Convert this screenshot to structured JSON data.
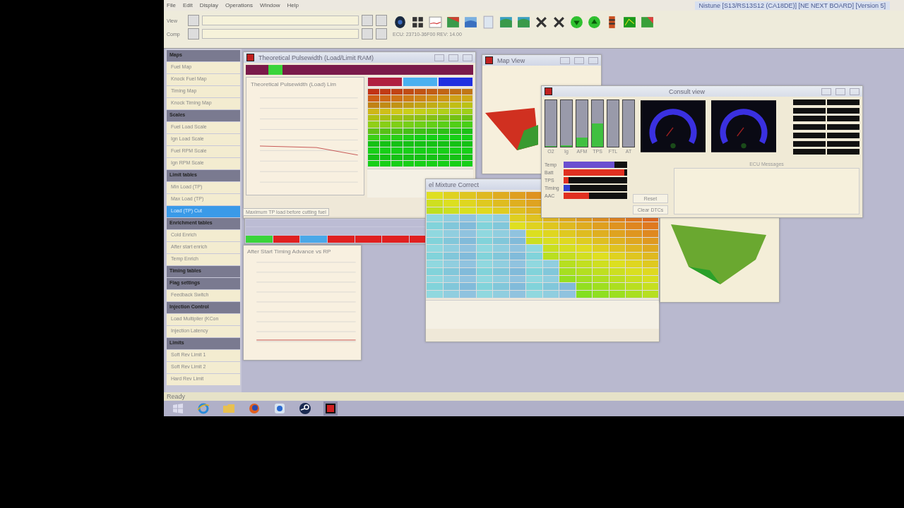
{
  "title": "Nistune [S13/RS13S12 (CA18DE)] [NE NEXT BOARD] [Version 5]",
  "menu": [
    "File",
    "Edit",
    "Display",
    "Operations",
    "Window",
    "Help"
  ],
  "toolbar": {
    "rows": [
      {
        "label": "View"
      },
      {
        "label": "Comp"
      }
    ],
    "ecu_info": "ECU: 23710-36F00 REV: 14.00"
  },
  "sidebar": {
    "groups": [
      {
        "label": "Maps",
        "children": [
          {
            "label": "Fuel Map",
            "selected": false
          },
          {
            "label": "Knock Fuel Map",
            "selected": false
          },
          {
            "label": "Timing Map",
            "selected": false
          },
          {
            "label": "Knock Timing Map",
            "selected": false
          }
        ]
      },
      {
        "label": "Scales",
        "children": [
          {
            "label": "Fuel Load Scale",
            "selected": false
          },
          {
            "label": "Ign Load Scale",
            "selected": false
          },
          {
            "label": "Fuel RPM Scale",
            "selected": false
          },
          {
            "label": "Ign RPM Scale",
            "selected": false
          }
        ]
      },
      {
        "label": "Limit tables",
        "children": [
          {
            "label": "Min Load (TP)",
            "selected": false
          },
          {
            "label": "Max Load (TP)",
            "selected": false
          },
          {
            "label": "Load (TP) Cut",
            "selected": true
          }
        ]
      },
      {
        "label": "Enrichment tables",
        "children": [
          {
            "label": "Cold Enrich",
            "selected": false
          },
          {
            "label": "After start enrich",
            "selected": false
          },
          {
            "label": "Temp Enrich",
            "selected": false
          }
        ]
      },
      {
        "label": "Timing tables"
      },
      {
        "label": "Flag settings",
        "children": [
          {
            "label": "Feedback Switch",
            "selected": false
          }
        ]
      },
      {
        "label": "Injection Control",
        "children": [
          {
            "label": "Load Multiplier (KCon",
            "selected": false
          },
          {
            "label": "Injection Latency",
            "selected": false
          }
        ]
      },
      {
        "label": "Limits",
        "children": [
          {
            "label": "Soft Rev Limit 1",
            "selected": false
          },
          {
            "label": "Soft Rev Limit 2",
            "selected": false
          },
          {
            "label": "Hard Rev Limit",
            "selected": false
          }
        ]
      }
    ]
  },
  "tooltip": "Maximum TP load before cutting fuel",
  "pulsewidth_window": {
    "title": "Theoretical Pulsewidth (Load/Limit RAM)",
    "chart_title": "Theoretical Pulsewidth (Load) Lim"
  },
  "timing_chart_window": {
    "title": "After Start Timing Advance vs RP"
  },
  "map_view_window": {
    "title": "Map View"
  },
  "mixture_window": {
    "title": "el Mixture Correct"
  },
  "consult_window": {
    "title": "Consult view",
    "bars": [
      {
        "label": "O2",
        "level": 0.02
      },
      {
        "label": "Ig",
        "level": 0.03
      },
      {
        "label": "AFM",
        "level": 0.2
      },
      {
        "label": "TPS",
        "level": 0.5
      },
      {
        "label": "FTL"
      },
      {
        "label": "AT"
      }
    ],
    "messages_label": "ECU Messages",
    "sensors": [
      {
        "label": "Temp",
        "level": 0.8,
        "color": "#6a4fd0"
      },
      {
        "label": "Batt",
        "level": 0.95,
        "color": "#e03020"
      },
      {
        "label": "TPS",
        "level": 0.08,
        "color": "#e03020"
      },
      {
        "label": "Timing",
        "level": 0.1,
        "color": "#3040d0"
      },
      {
        "label": "AAC",
        "level": 0.4,
        "color": "#e03020"
      }
    ],
    "buttons": [
      "Reset",
      "Clear DTCs"
    ]
  },
  "status": "Ready"
}
